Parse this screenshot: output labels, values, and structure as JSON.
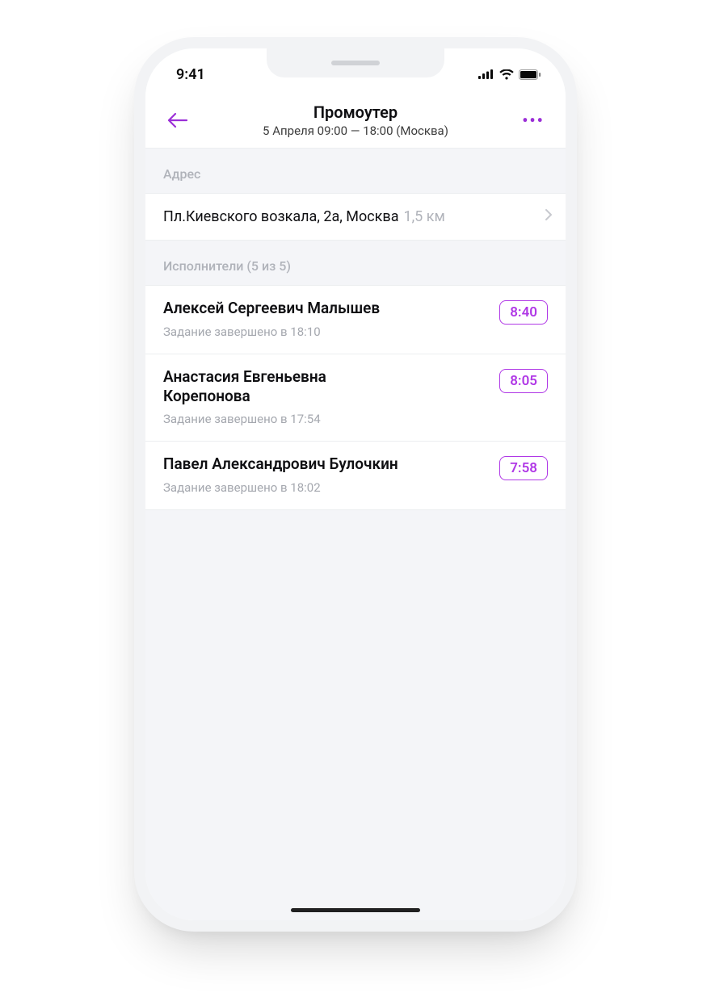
{
  "status": {
    "time": "9:41"
  },
  "header": {
    "title": "Промоутер",
    "subtitle": "5 Апреля 09:00 — 18:00 (Москва)"
  },
  "address": {
    "section_label": "Адрес",
    "text": "Пл.Киевского возкала, 2а, Москва",
    "distance": "1,5 км"
  },
  "performers": {
    "section_label": "Исполнители (5 из 5)",
    "items": [
      {
        "name": "Алексей Сергеевич Малышев",
        "status": "Задание завершено в 18:10",
        "time": "8:40"
      },
      {
        "name": "Анастасия Евгеньевна Корепонова",
        "status": "Задание завершено в 17:54",
        "time": "8:05"
      },
      {
        "name": "Павел Александрович Булочкин",
        "status": "Задание завершено в 18:02",
        "time": "7:58"
      }
    ]
  },
  "colors": {
    "accent": "#b038e6"
  }
}
